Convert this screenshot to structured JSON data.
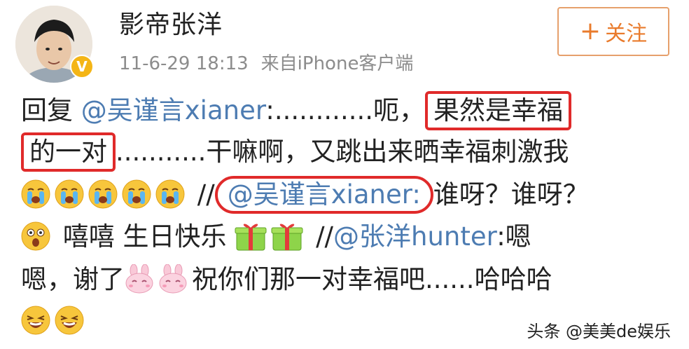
{
  "post": {
    "username": "影帝张洋",
    "time": "11-6-29 18:13",
    "source": "来自iPhone客户端",
    "follow_label": "关注",
    "lines": {
      "l1": {
        "prefix": "回复 ",
        "mention": "@吴谨言xianer",
        "mid": ":............呃，",
        "highlight": "果然是幸福"
      },
      "l2": {
        "highlight": "的一对",
        "rest": "...........干嘛啊，又跳出来晒幸福刺激我"
      },
      "l3": {
        "sep": "//",
        "mention": "@吴谨言xianer:",
        "rest": "谁呀？谁呀？"
      },
      "l4": {
        "text": " 嘻嘻 生日快乐",
        "sep": "//",
        "mention": "@张洋hunter",
        "rest": ":嗯"
      },
      "l5": {
        "start": "嗯，谢了",
        "rest": "祝你们那一对幸福吧......哈哈哈"
      }
    }
  },
  "icons": {
    "crying": "crying-emoji-icon",
    "shocked": "shocked-emoji-icon",
    "gift": "gift-emoji-icon",
    "bunny": "bunny-emoji-icon",
    "laughing": "laughing-emoji-icon",
    "verified": "verified-v-icon",
    "follow_plus": "plus-icon"
  },
  "watermark": "头条 @美美de娱乐",
  "colors": {
    "mention": "#4d7cb2",
    "follow": "#e97b2c",
    "highlight_border": "#e02a2a",
    "verified": "#f4b516"
  }
}
